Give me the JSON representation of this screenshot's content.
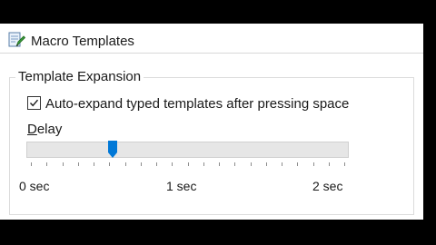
{
  "window": {
    "title": "Macro Templates",
    "icon": "document-pencil-icon"
  },
  "group": {
    "title": "Template Expansion"
  },
  "auto_expand": {
    "label": "Auto-expand typed templates after pressing space",
    "checked": true
  },
  "delay": {
    "label_mnemonic": "D",
    "label_rest": "elay",
    "value_fraction": 0.26,
    "tick_count": 21,
    "tick_labels": [
      "0 sec",
      "1 sec",
      "2 sec"
    ]
  },
  "colors": {
    "accent": "#0078d7",
    "track": "#e6e6e6",
    "background": "#ffffff",
    "frame": "#000000"
  }
}
